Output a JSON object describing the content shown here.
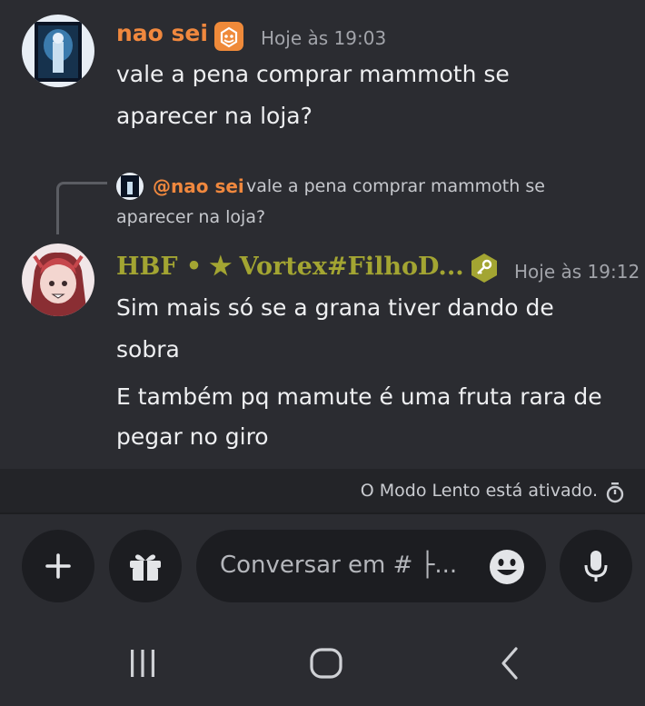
{
  "messages": [
    {
      "author": "nao sei",
      "timestamp": "Hoje às 19:03",
      "lines": [
        "vale a pena comprar mammoth se",
        "aparecer na loja?"
      ],
      "author_color": "#f0883e"
    },
    {
      "reply_preview": {
        "mention": "@nao sei",
        "text_line1": "vale a pena comprar mammoth se",
        "text_line2": "aparecer na loja?"
      },
      "author": "HBF • ✭ Vortex#FilhoD...",
      "timestamp": "Hoje às 19:12",
      "paragraphs": [
        [
          "Sim mais só se a grana tiver dando de",
          "sobra"
        ],
        [
          "E também pq mamute é uma fruta rara de",
          "pegar no giro"
        ]
      ],
      "author_color": "#a3a532"
    }
  ],
  "slowmode": {
    "text": "O Modo Lento está ativado."
  },
  "composer": {
    "placeholder": "Conversar em # ├...",
    "buttons": [
      "plus-icon",
      "gift-icon",
      "emoji-icon",
      "microphone-icon"
    ]
  },
  "system_nav": {
    "icons": [
      "recent-apps-icon",
      "home-icon",
      "back-icon"
    ]
  },
  "colors": {
    "background": "#2b2c31",
    "orange_accent": "#f0883e",
    "olive_accent": "#a3a532"
  }
}
